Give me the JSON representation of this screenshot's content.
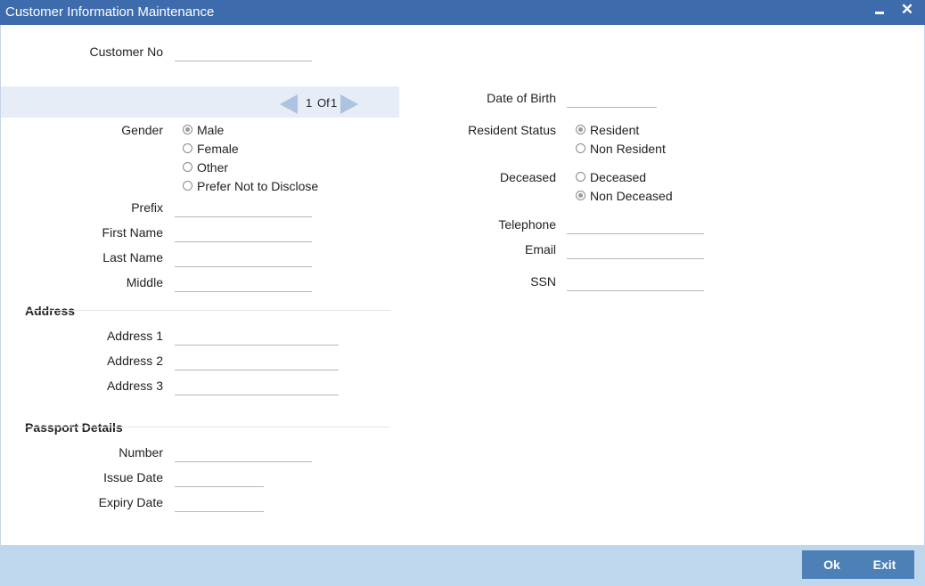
{
  "window": {
    "title": "Customer Information Maintenance",
    "minimize_icon": "minimize-icon",
    "close_icon": "close-icon",
    "close_glyph": "✕"
  },
  "customer": {
    "customer_no_label": "Customer No",
    "customer_no_value": ""
  },
  "pager": {
    "current": "1",
    "of_label": "Of",
    "total": "1",
    "prev_icon": "triangle-left-icon",
    "next_icon": "triangle-right-icon"
  },
  "gender": {
    "label": "Gender",
    "options": [
      "Male",
      "Female",
      "Other",
      "Prefer Not to Disclose"
    ],
    "selected": "Male"
  },
  "name": {
    "prefix_label": "Prefix",
    "first_label": "First Name",
    "last_label": "Last Name",
    "middle_label": "Middle",
    "prefix_value": "",
    "first_value": "",
    "last_value": "",
    "middle_value": ""
  },
  "address": {
    "section_label": "Address",
    "address1_label": "Address 1",
    "address2_label": "Address 2",
    "address3_label": "Address 3",
    "address1_value": "",
    "address2_value": "",
    "address3_value": ""
  },
  "passport": {
    "section_label": "Passport Details",
    "number_label": "Number",
    "issue_date_label": "Issue Date",
    "expiry_date_label": "Expiry Date",
    "number_value": "",
    "issue_date_value": "",
    "expiry_date_value": ""
  },
  "right": {
    "dob_label": "Date of Birth",
    "dob_value": "",
    "resident_status_label": "Resident Status",
    "resident_options": [
      "Resident",
      "Non Resident"
    ],
    "resident_selected": "Resident",
    "deceased_label": "Deceased",
    "deceased_options": [
      "Deceased",
      "Non Deceased"
    ],
    "deceased_selected": "Non Deceased",
    "telephone_label": "Telephone",
    "email_label": "Email",
    "ssn_label": "SSN",
    "telephone_value": "",
    "email_value": "",
    "ssn_value": ""
  },
  "footer": {
    "ok_label": "Ok",
    "exit_label": "Exit"
  },
  "colors": {
    "titlebar": "#3d6bab",
    "footer": "#bfd7ed",
    "button": "#4e80b8",
    "nav_band": "#e6edf7",
    "nav_arrow": "#adc3e0"
  }
}
